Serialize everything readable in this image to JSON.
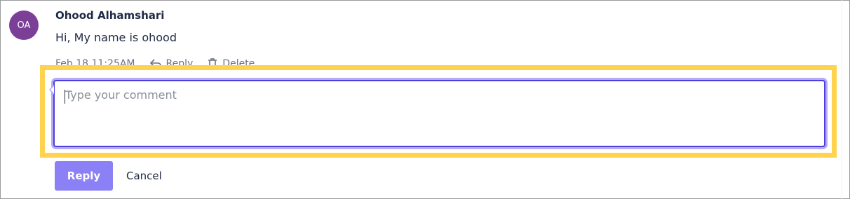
{
  "comment": {
    "avatar_initials": "OA",
    "author": "Ohood Alhamshari",
    "text": "Hi, My name is ohood",
    "timestamp": "Feb 18 11:25AM",
    "reply_label": "Reply",
    "delete_label": "Delete"
  },
  "editor": {
    "placeholder": "Type your comment",
    "value": ""
  },
  "actions": {
    "reply_label": "Reply",
    "cancel_label": "Cancel"
  },
  "colors": {
    "avatar_bg": "#7b3f98",
    "accent": "#8b80f5",
    "focus_border": "#4b3fe0",
    "highlight": "#ffd34d"
  },
  "icons": {
    "reply": "reply-arrow-icon",
    "delete": "trash-icon"
  }
}
